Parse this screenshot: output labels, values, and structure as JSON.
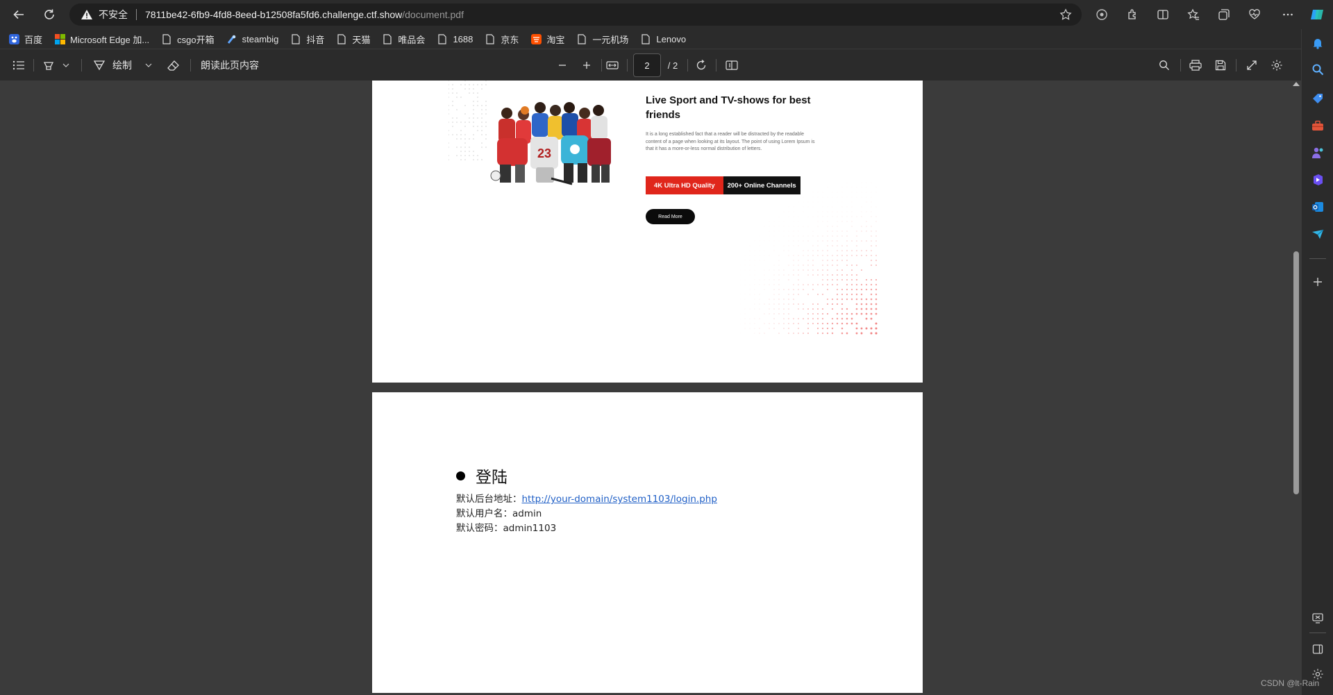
{
  "browser": {
    "address": {
      "security_label": "不安全",
      "url_host": "7811be42-6fb9-4fd8-8eed-b12508fa5fd6.challenge.ctf.show",
      "url_path": "/document.pdf"
    },
    "icons": [
      "back-icon",
      "refresh-icon",
      "warning-icon",
      "star-icon",
      "copilot-icon",
      "extensions-icon",
      "split-screen-icon",
      "favorites-icon",
      "collections-icon",
      "browser-essentials-icon",
      "more-icon",
      "edge-copilot-icon"
    ]
  },
  "bookmarks": [
    {
      "label": "百度",
      "icon": "baidu-icon"
    },
    {
      "label": "Microsoft Edge 加...",
      "icon": "microsoft-icon"
    },
    {
      "label": "csgo开箱",
      "icon": "page-icon"
    },
    {
      "label": "steambig",
      "icon": "steam-icon"
    },
    {
      "label": "抖音",
      "icon": "page-icon"
    },
    {
      "label": "天猫",
      "icon": "page-icon"
    },
    {
      "label": "唯品会",
      "icon": "page-icon"
    },
    {
      "label": "1688",
      "icon": "page-icon"
    },
    {
      "label": "京东",
      "icon": "page-icon"
    },
    {
      "label": "淘宝",
      "icon": "taobao-icon"
    },
    {
      "label": "一元机场",
      "icon": "page-icon"
    },
    {
      "label": "Lenovo",
      "icon": "page-icon"
    }
  ],
  "pdf_toolbar": {
    "draw_label": "绘制",
    "read_aloud_label": "朗读此页内容",
    "current_page": "2",
    "total_pages": "/ 2"
  },
  "page1": {
    "title": "Live Sport and TV-shows for best friends",
    "body": "It is a long established fact that a reader will be distracted by the readable content of a page when looking at its layout. The point of using Lorem Ipsum is that it has a more-or-less normal distribution of letters.",
    "badge_red": "4K Ultra HD Quality",
    "badge_black": "200+ Online Channels",
    "button": "Read More",
    "colors": {
      "accent_red": "#e0261b",
      "dark": "#111111"
    }
  },
  "page2": {
    "heading": "登陆",
    "backend_label": "默认后台地址：",
    "backend_url": "http://your-domain/system1103/login.php",
    "username_label": "默认用户名：",
    "username": "admin",
    "password_label": "默认密码：",
    "password": "admin1103"
  },
  "watermark": "CSDN @lt-Rain"
}
